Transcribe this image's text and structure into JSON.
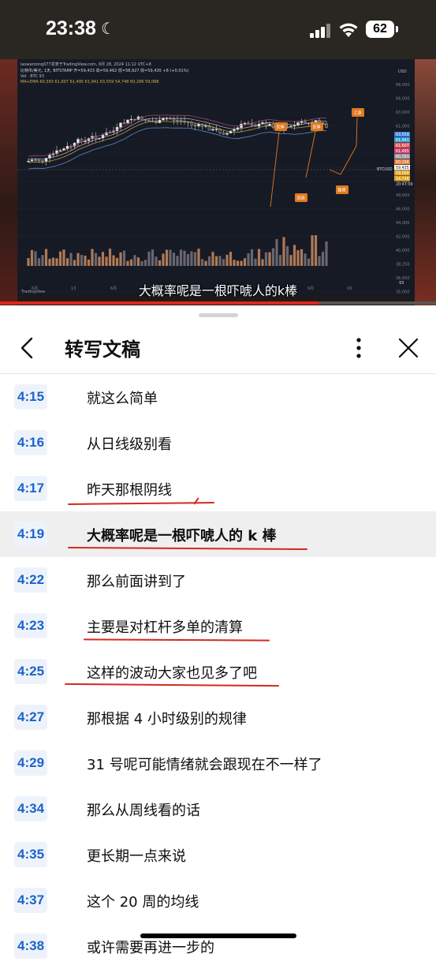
{
  "status_bar": {
    "time": "23:38",
    "battery": "62"
  },
  "video": {
    "subtitle": "大概率呢是一根吓唬人的k棒",
    "progress": 0.73,
    "chart": {
      "header_line": "laowantong077发表于TradingView.com, 8月 28, 2024 11:12 UTC+8",
      "symbol_line": "比特币/美元, 1天, BITSTAMP 开=59,433 高=59,462 低=58,927 收=59,435 +8 (+0.01%)",
      "vol_line": "Vol · BTC 93",
      "ma_line": "MA+EMA 60,393 61,607 61,495 61,941 63,559 54,748 60,296 59,068",
      "currency": "USD",
      "price_ticks": [
        "68,000",
        "66,000",
        "63,000",
        "61,000",
        "58,000",
        "56,000",
        "54,000",
        "52,000",
        "49,000",
        "46,000",
        "44,000",
        "42,000",
        "40,000",
        "38,250",
        "36,650",
        "35,000"
      ],
      "price_tags": [
        "63,559",
        "61,941",
        "61,607",
        "61,495",
        "60,393",
        "60,296",
        "59,435",
        "59,068",
        "54,748"
      ],
      "date_labels": [
        "6月",
        "13",
        "6月",
        "7月",
        "15",
        "8月",
        "22",
        "9月",
        "16"
      ],
      "symbol_tag": "BTCUSD",
      "clock_tag": "20:47:09",
      "annotations": [
        "反弹",
        "反弹",
        "上涨",
        "回调",
        "整理"
      ],
      "brand": "TradingView",
      "volume_tag": "93"
    }
  },
  "sheet": {
    "title": "转写文稿",
    "rows": [
      {
        "time": "4:15",
        "text": "就这么简单"
      },
      {
        "time": "4:16",
        "text": "从日线级别看"
      },
      {
        "time": "4:17",
        "text": "昨天那根阴线"
      },
      {
        "time": "4:19",
        "text": "大概率呢是一根吓唬人的 k 棒"
      },
      {
        "time": "4:22",
        "text": "那么前面讲到了"
      },
      {
        "time": "4:23",
        "text": "主要是对杠杆多单的清算"
      },
      {
        "time": "4:25",
        "text": "这样的波动大家也见多了吧"
      },
      {
        "time": "4:27",
        "text": "那根据 4 小时级别的规律"
      },
      {
        "time": "4:29",
        "text": "31 号呢可能情绪就会跟现在不一样了"
      },
      {
        "time": "4:34",
        "text": "那么从周线看的话"
      },
      {
        "time": "4:35",
        "text": "更长期一点来说"
      },
      {
        "time": "4:37",
        "text": "这个 20 周的均线"
      },
      {
        "time": "4:38",
        "text": "或许需要再进一步的"
      }
    ]
  },
  "colors": {
    "accent_blue": "#1a64c9",
    "underline_red": "#d32a1f",
    "progress_red": "#e1251b"
  }
}
